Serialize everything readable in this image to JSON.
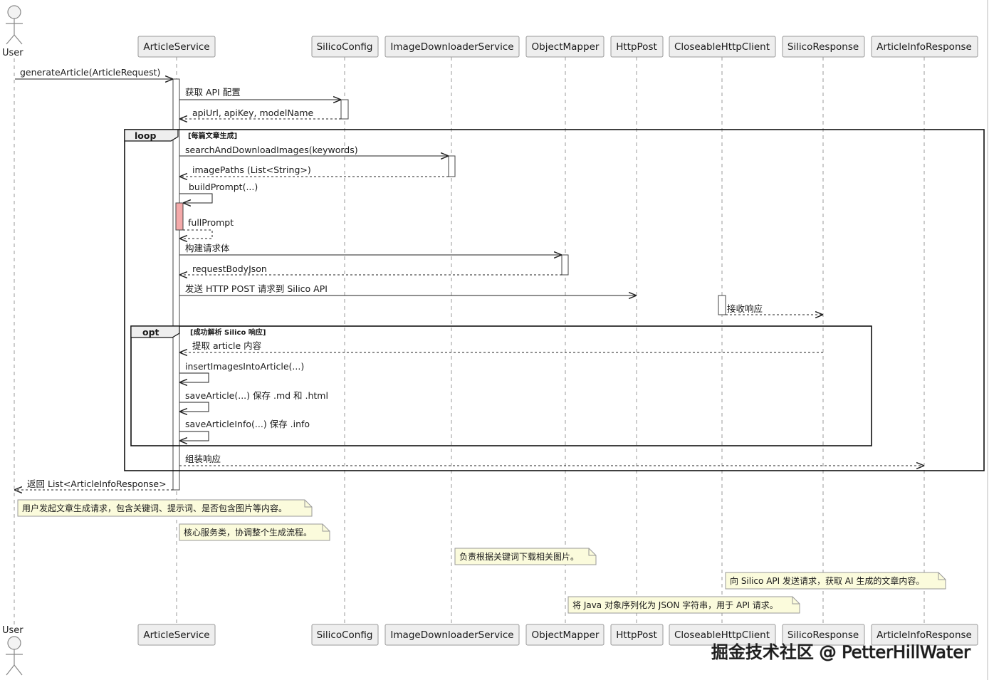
{
  "actor": {
    "label": "User"
  },
  "participants": [
    "ArticleService",
    "SilicoConfig",
    "ImageDownloaderService",
    "ObjectMapper",
    "HttpPost",
    "CloseableHttpClient",
    "SilicoResponse",
    "ArticleInfoResponse"
  ],
  "messages": {
    "m1": "generateArticle(ArticleRequest)",
    "m2": "获取 API 配置",
    "m3": "apiUrl, apiKey, modelName",
    "m4": "searchAndDownloadImages(keywords)",
    "m5": "imagePaths (List<String>)",
    "m6": "buildPrompt(...)",
    "m7": "fullPrompt",
    "m8": "构建请求体",
    "m9": "requestBodyJson",
    "m10": "发送 HTTP POST 请求到 Silico API",
    "m11": "接收响应",
    "m12": "提取 article 内容",
    "m13": "insertImagesIntoArticle(...)",
    "m14": "saveArticle(...) 保存 .md 和 .html",
    "m15": "saveArticleInfo(...) 保存 .info",
    "m16": "组装响应",
    "m17": "返回 List<ArticleInfoResponse>"
  },
  "frames": {
    "loop": {
      "keyword": "loop",
      "guard": "[每篇文章生成]"
    },
    "opt": {
      "keyword": "opt",
      "guard": "[成功解析 Silico 响应]"
    }
  },
  "notes": {
    "n1": "用户发起文章生成请求，包含关键词、提示词、是否包含图片等内容。",
    "n2": "核心服务类，协调整个生成流程。",
    "n3": "负责根据关键词下载相关图片。",
    "n4": "向 Silico API 发送请求，获取 AI 生成的文章内容。",
    "n5": "将 Java 对象序列化为 JSON 字符串，用于 API 请求。"
  },
  "watermark": "掘金技术社区 @ PetterHillWater",
  "colors": {
    "participant_fill": "#eeeeee",
    "participant_border": "#999999",
    "note_fill": "#fbfbdc",
    "highlight_activation": "#f4a9a9",
    "line": "#222222"
  }
}
